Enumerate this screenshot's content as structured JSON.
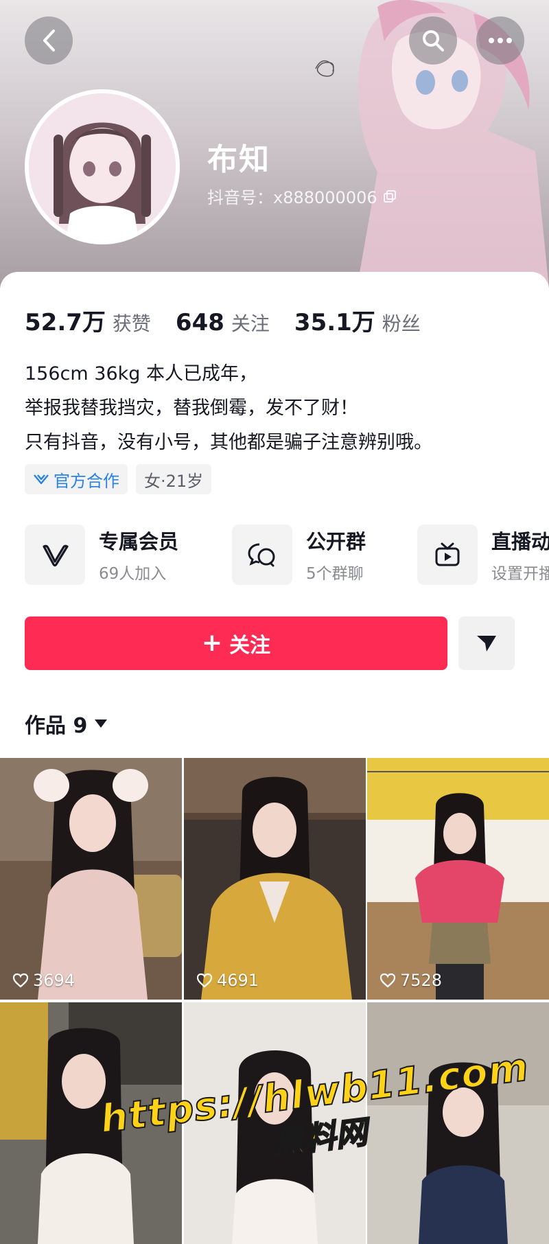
{
  "profile": {
    "nickname": "布知",
    "douyin_id": "抖音号：x888000006"
  },
  "stats": [
    {
      "value": "52.7万",
      "label": "获赞"
    },
    {
      "value": "648",
      "label": "关注"
    },
    {
      "value": "35.1万",
      "label": "粉丝"
    }
  ],
  "bio": [
    "156cm   36kg   本人已成年，",
    "举报我替我挡灾，替我倒霉，发不了财！",
    "只有抖音，没有小号，其他都是骗子注意辨别哦。"
  ],
  "tags": {
    "official": "官方合作",
    "gender_age": "女·21岁"
  },
  "features": [
    {
      "title": "专属会员",
      "sub": "69人加入",
      "icon": "vip-icon"
    },
    {
      "title": "公开群",
      "sub": "5个群聊",
      "icon": "group-chat-icon"
    },
    {
      "title": "直播动态",
      "sub": "设置开播提醒",
      "icon": "live-tv-icon"
    }
  ],
  "actions": {
    "follow_label": "关注",
    "follow_icon": "+"
  },
  "works": {
    "label": "作品 9",
    "items": [
      {
        "likes": "3694"
      },
      {
        "likes": "4691"
      },
      {
        "likes": "7528"
      },
      {
        "likes": ""
      },
      {
        "likes": ""
      },
      {
        "likes": ""
      }
    ]
  },
  "watermark": {
    "url": "https://hlwb11.com",
    "name": "黑料网"
  },
  "colors": {
    "accent": "#fe2c55",
    "official_tag": "#2a83e4",
    "watermark": "#ffd21a"
  }
}
